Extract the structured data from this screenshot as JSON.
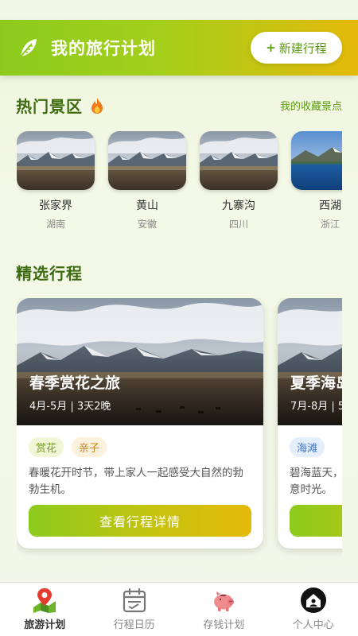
{
  "header": {
    "title": "我的旅行计划",
    "logo_icon": "leaf-icon",
    "new_button": {
      "plus": "+",
      "label": "新建行程"
    }
  },
  "hot_spots": {
    "title": "热门景区",
    "title_icon": "fire-icon",
    "link_label": "我的收藏景点",
    "items": [
      {
        "name": "张家界",
        "region": "湖南",
        "image": "mountain-plateau"
      },
      {
        "name": "黄山",
        "region": "安徽",
        "image": "mountain-plateau"
      },
      {
        "name": "九寨沟",
        "region": "四川",
        "image": "mountain-plateau"
      },
      {
        "name": "西湖",
        "region": "浙江",
        "image": "lake-mountain"
      }
    ]
  },
  "featured": {
    "title": "精选行程",
    "trips": [
      {
        "name": "春季赏花之旅",
        "meta": "4月-5月 | 3天2晚",
        "tags": [
          {
            "label": "赏花",
            "style": "green"
          },
          {
            "label": "亲子",
            "style": "orange"
          }
        ],
        "desc": "春暖花开时节，带上家人一起感受大自然的勃勃生机。",
        "button_label": "查看行程详情"
      },
      {
        "name": "夏季海岛",
        "meta": "7月-8月 | 5",
        "tags": [
          {
            "label": "海滩",
            "style": "blue"
          }
        ],
        "desc": "碧海蓝天，\n意时光。",
        "button_label": ""
      }
    ]
  },
  "tabbar": {
    "items": [
      {
        "label": "旅游计划",
        "icon": "map-pin-icon",
        "active": true
      },
      {
        "label": "行程日历",
        "icon": "calendar-icon",
        "active": false
      },
      {
        "label": "存钱计划",
        "icon": "piggy-bank-icon",
        "active": false
      },
      {
        "label": "个人中心",
        "icon": "home-user-icon",
        "active": false
      }
    ]
  },
  "colors": {
    "accent_green": "#8ccb1e",
    "accent_orange": "#e5b90a",
    "title_green": "#3e6b12"
  }
}
